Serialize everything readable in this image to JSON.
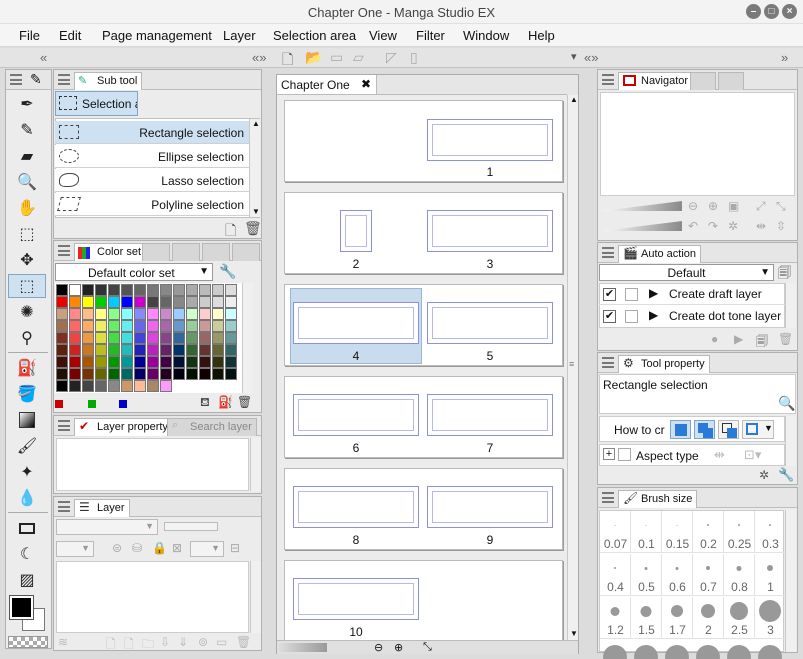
{
  "window": {
    "title": "Chapter One - Manga Studio EX"
  },
  "menu": [
    "File",
    "Edit",
    "Page management",
    "Layer",
    "Selection area",
    "View",
    "Filter",
    "Window",
    "Help"
  ],
  "subtool": {
    "tab": "Sub tool",
    "current": "Selection ar",
    "items": [
      "Rectangle selection",
      "Ellipse selection",
      "Lasso selection",
      "Polyline selection"
    ]
  },
  "colorset": {
    "tab": "Color set",
    "selected": "Default color set"
  },
  "layer_property": {
    "tab": "Layer property",
    "tab2": "Search layer"
  },
  "layer": {
    "tab": "Layer"
  },
  "document": {
    "tab": "Chapter One",
    "pages": [
      {
        "labels": [
          "1"
        ]
      },
      {
        "labels": [
          "2",
          "3"
        ]
      },
      {
        "labels": [
          "4",
          "5"
        ]
      },
      {
        "labels": [
          "6",
          "7"
        ]
      },
      {
        "labels": [
          "8",
          "9"
        ]
      },
      {
        "labels": [
          "10"
        ]
      }
    ]
  },
  "navigator": {
    "tab": "Navigator"
  },
  "auto_action": {
    "tab": "Auto action",
    "selected": "Default",
    "items": [
      "Create draft layer",
      "Create dot tone layer"
    ]
  },
  "tool_property": {
    "tab": "Tool property",
    "tool_name": "Rectangle selection",
    "how_to": "How to cr",
    "aspect": "Aspect type"
  },
  "brush_size": {
    "tab": "Brush size",
    "row1": [
      "0.07",
      "0.1",
      "0.15",
      "0.2",
      "0.25",
      "0.3"
    ],
    "row2": [
      "0.4",
      "0.5",
      "0.6",
      "0.7",
      "0.8",
      "1"
    ],
    "row3": [
      "1.2",
      "1.5",
      "1.7",
      "2",
      "2.5",
      "3"
    ]
  },
  "colors": {
    "accent": "#cde1f2",
    "frame": "#8d8fe0"
  }
}
